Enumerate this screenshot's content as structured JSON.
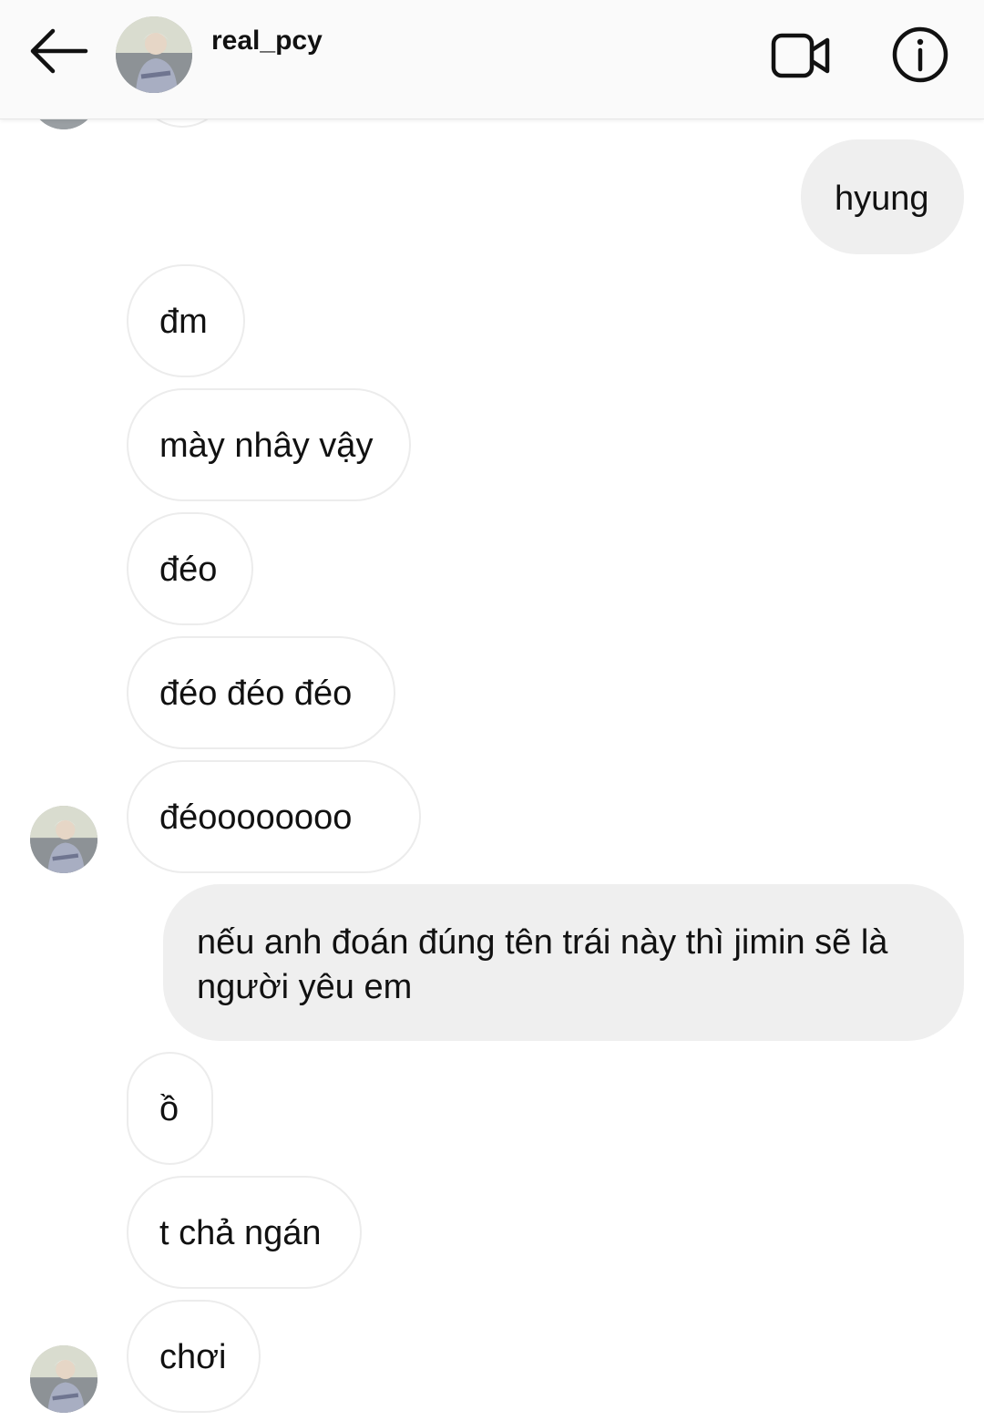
{
  "header": {
    "username": "real_pcy",
    "back_icon": "arrow-left-icon",
    "video_icon": "video-camera-icon",
    "info_icon": "info-icon"
  },
  "messages": [
    {
      "from": "me",
      "text": "hyung"
    },
    {
      "from": "them",
      "text": "đm"
    },
    {
      "from": "them",
      "text": "mày nhây vậy"
    },
    {
      "from": "them",
      "text": "đéo"
    },
    {
      "from": "them",
      "text": "đéo đéo đéo"
    },
    {
      "from": "them",
      "text": "đéoooooooo"
    },
    {
      "from": "me",
      "lines": [
        "nếu anh đoán đúng tên trái này thì jimin sẽ là",
        "người yêu em"
      ]
    },
    {
      "from": "them",
      "text": "ồ"
    },
    {
      "from": "them",
      "text": "t chả ngán"
    },
    {
      "from": "them",
      "text": "chơi"
    }
  ],
  "colors": {
    "sent_bubble": "#efefef",
    "received_border": "#ececec",
    "header_bg": "#fafafa"
  }
}
